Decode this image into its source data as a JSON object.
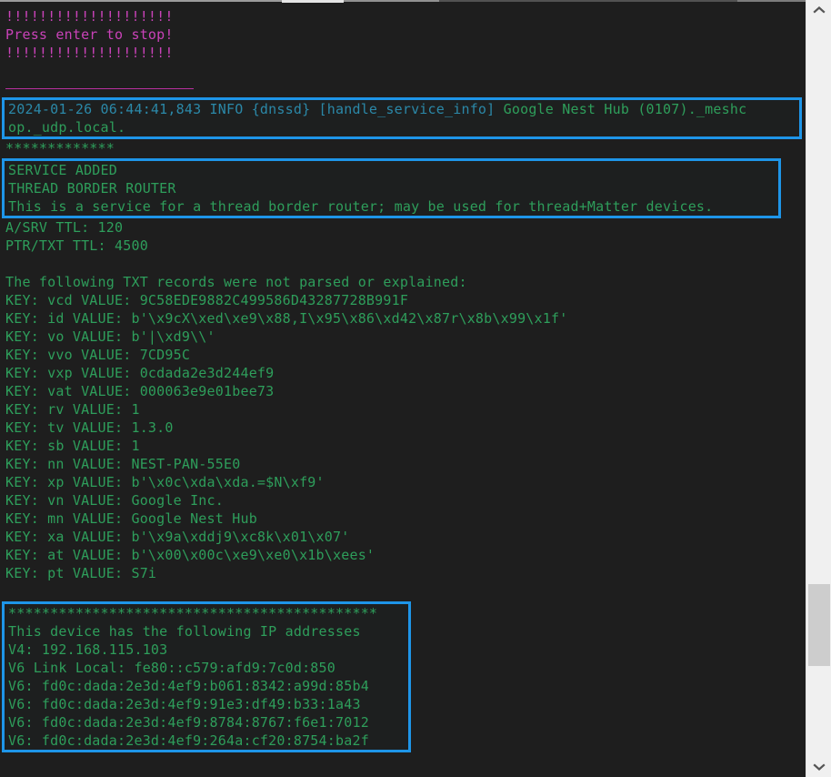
{
  "window": {
    "background_color": "#1e1e1e",
    "text_color": "#2e9e5b",
    "accent_color": "#1e95e8",
    "magenta_color": "#c942b8",
    "teal_color": "#2b88a8"
  },
  "console": {
    "banner": {
      "bang_line_top": "!!!!!!!!!!!!!!!!!!!!",
      "press_enter": "Press enter to stop!",
      "bang_line_bottom": "!!!!!!!!!!!!!!!!!!!!"
    },
    "log_entry": {
      "prefix": "2024-01-26 06:44:41,843 INFO {dnssd} [handle_service_info]",
      "service": " Google Nest Hub (0107)._meshcop._udp.local.",
      "line1_visible": "2024-01-26 06:44:41,843 INFO {dnssd} [handle_service_info]",
      "line1_green": " Google Nest Hub (0107)._meshc",
      "line2": "op._udp.local."
    },
    "separator_stars_short": "*************",
    "service_block": {
      "line1": "SERVICE ADDED",
      "line2": "THREAD BORDER ROUTER",
      "line3": "This is a service for a thread border router; may be used for thread+Matter devices."
    },
    "ttl": {
      "a_srv": "A/SRV TTL: 120",
      "ptr_txt": "PTR/TXT TTL: 4500"
    },
    "txt_records_header": "The following TXT records were not parsed or explained:",
    "txt_records": [
      "KEY: vcd VALUE: 9C58EDE9882C499586D43287728B991F",
      "KEY: id VALUE: b'\\x9cX\\xed\\xe9\\x88,I\\x95\\x86\\xd42\\x87r\\x8b\\x99\\x1f'",
      "KEY: vo VALUE: b'|\\xd9\\\\'",
      "KEY: vvo VALUE: 7CD95C",
      "KEY: vxp VALUE: 0cdada2e3d244ef9",
      "KEY: vat VALUE: 000063e9e01bee73",
      "KEY: rv VALUE: 1",
      "KEY: tv VALUE: 1.3.0",
      "KEY: sb VALUE: 1",
      "KEY: nn VALUE: NEST-PAN-55E0",
      "KEY: xp VALUE: b'\\x0c\\xda\\xda.=$N\\xf9'",
      "KEY: vn VALUE: Google Inc.",
      "KEY: mn VALUE: Google Nest Hub",
      "KEY: xa VALUE: b'\\x9a\\xddj9\\xc8k\\x01\\x07'",
      "KEY: at VALUE: b'\\x00\\x00c\\xe9\\xe0\\x1b\\xees'",
      "KEY: pt VALUE: S7i"
    ],
    "ip_block": {
      "stars": "********************************************",
      "header": "This device has the following IP addresses",
      "addresses": [
        "V4: 192.168.115.103",
        "V6 Link Local: fe80::c579:afd9:7c0d:850",
        "V6: fd0c:dada:2e3d:4ef9:b061:8342:a99d:85b4",
        "V6: fd0c:dada:2e3d:4ef9:91e3:df49:b33:1a43",
        "V6: fd0c:dada:2e3d:4ef9:8784:8767:f6e1:7012",
        "V6: fd0c:dada:2e3d:4ef9:264a:cf20:8754:ba2f"
      ]
    }
  },
  "scrollbar": {
    "up_arrow": "˄",
    "down_arrow": "˅"
  }
}
